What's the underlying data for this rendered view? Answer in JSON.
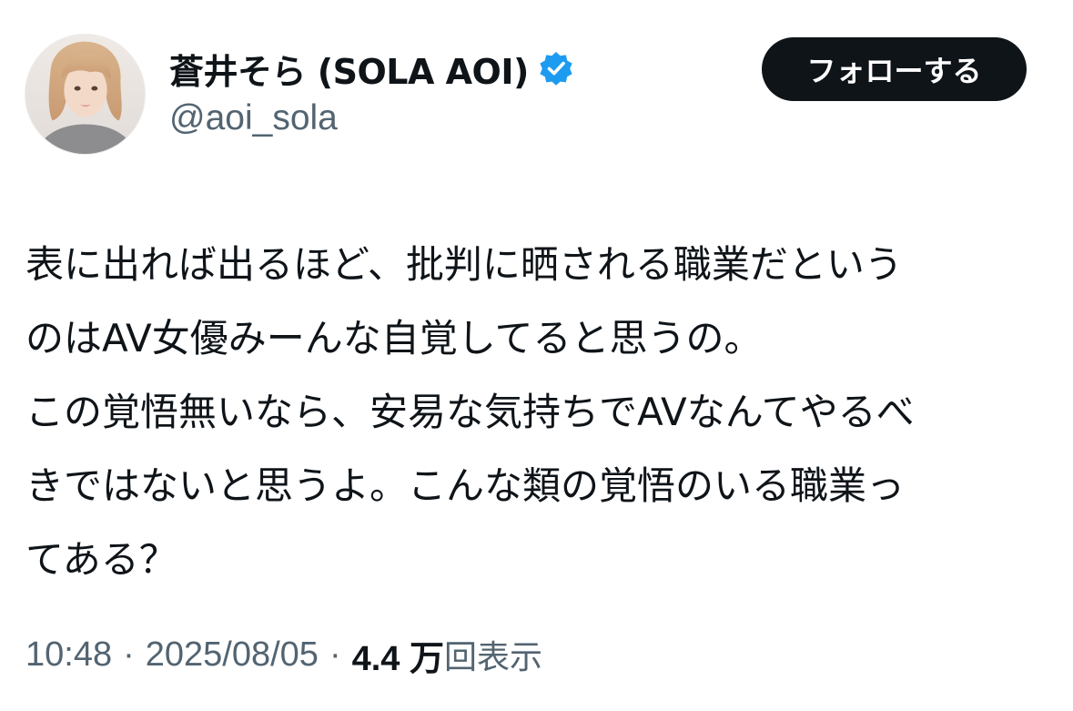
{
  "user": {
    "display_name": "蒼井そら (SOLA AOI)",
    "handle": "@aoi_sola",
    "avatar_icon": "profile-photo",
    "verified_icon": "verified-badge-icon",
    "verified_color": "#1d9bf0"
  },
  "actions": {
    "follow_label": "フォローする"
  },
  "tweet": {
    "lines": [
      "表に出れば出るほど、批判に晒される職業だという",
      "のはAV女優みーんな自覚してると思うの。",
      "この覚悟無いなら、安易な気持ちでAVなんてやるべ",
      "きではないと思うよ。こんな類の覚悟のいる職業っ",
      "てある？"
    ]
  },
  "meta": {
    "time": "10:48",
    "separator": "·",
    "date": "2025/08/05",
    "views_count": "4.4 万",
    "views_label": "回表示"
  },
  "colors": {
    "text_primary": "#0f1419",
    "text_secondary": "#536471",
    "button_bg": "#0f1419",
    "button_text": "#ffffff"
  }
}
